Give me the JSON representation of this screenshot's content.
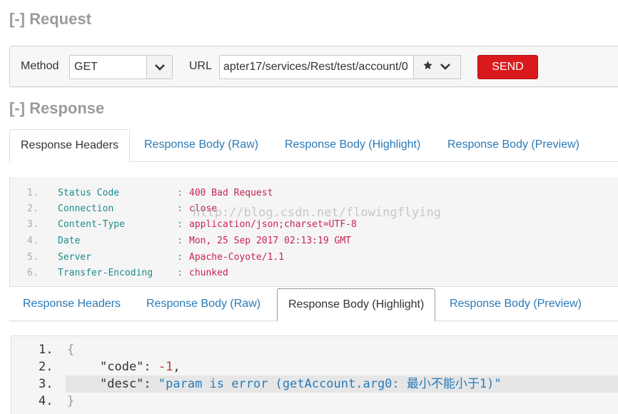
{
  "request": {
    "toggle": "[-]",
    "title": "Request",
    "method_label": "Method",
    "method_value": "GET",
    "url_label": "URL",
    "url_value": "apter17/services/Rest/test/account/0",
    "send_label": "SEND"
  },
  "response": {
    "toggle": "[-]",
    "title": "Response",
    "tabs": [
      {
        "label": "Response Headers"
      },
      {
        "label": "Response Body (Raw)"
      },
      {
        "label": "Response Body (Highlight)"
      },
      {
        "label": "Response Body (Preview)"
      }
    ],
    "headers": [
      {
        "num": "1.",
        "key": "Status Code",
        "value": "400 Bad Request"
      },
      {
        "num": "2.",
        "key": "Connection",
        "value": "close"
      },
      {
        "num": "3.",
        "key": "Content-Type",
        "value": "application/json;charset=UTF-8"
      },
      {
        "num": "4.",
        "key": "Date",
        "value": "Mon, 25 Sep 2017 02:13:19 GMT"
      },
      {
        "num": "5.",
        "key": "Server",
        "value": "Apache-Coyote/1.1"
      },
      {
        "num": "6.",
        "key": "Transfer-Encoding",
        "value": "chunked"
      }
    ],
    "separator": ":",
    "watermark": "http://blog.csdn.net/flowingflying",
    "body_tabs": [
      {
        "label": "Response Headers"
      },
      {
        "label": "Response Body (Raw)"
      },
      {
        "label": "Response Body (Highlight)"
      },
      {
        "label": "Response Body (Preview)"
      }
    ],
    "json_lines": {
      "l1": {
        "num": "1.",
        "open": "{"
      },
      "l2": {
        "num": "2.",
        "key": "\"code\"",
        "colon": ": ",
        "value": "-1",
        "comma": ","
      },
      "l3": {
        "num": "3.",
        "key": "\"desc\"",
        "colon": ": ",
        "value": "\"param is error (getAccount.arg0: 最小不能小于1)\""
      },
      "l4": {
        "num": "4.",
        "close": "}"
      }
    }
  },
  "colors": {
    "accent_link": "#2a7ab6",
    "send_button": "#d9191c",
    "header_key": "#1e8a8a",
    "header_value": "#c7254e"
  },
  "icons": {
    "method_caret": "chevron-down-icon",
    "url_star": "star-icon",
    "url_caret": "chevron-down-icon"
  }
}
